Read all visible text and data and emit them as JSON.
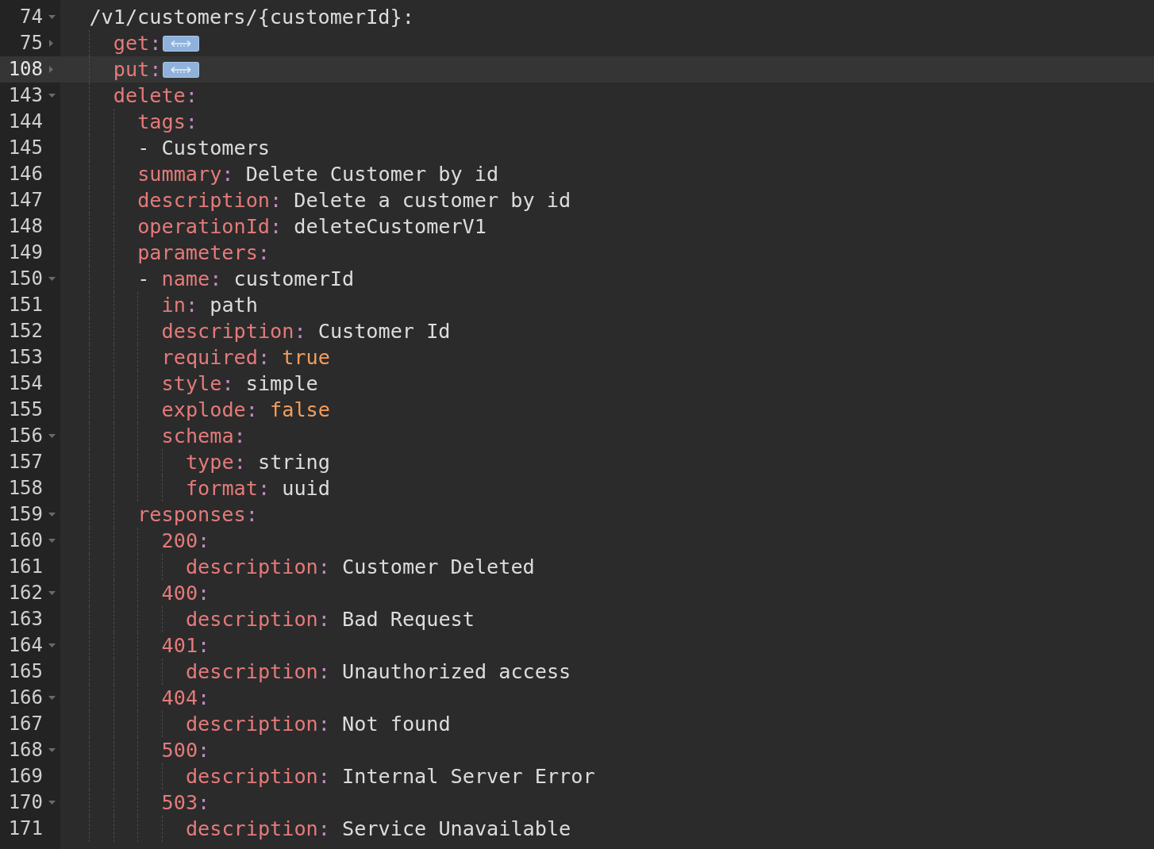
{
  "editor": {
    "lines": [
      {
        "number": "74",
        "kind": "expanded",
        "active": false,
        "tokens": [
          {
            "kind": "text",
            "text": "/v1/customers/{customerId}:"
          }
        ],
        "children": [
          {
            "number": "75",
            "kind": "collapsed",
            "active": false,
            "tokens": [
              {
                "kind": "key",
                "text": "get"
              },
              {
                "kind": "colon",
                "text": ":"
              }
            ]
          },
          {
            "number": "108",
            "kind": "collapsed",
            "active": true,
            "tokens": [
              {
                "kind": "key",
                "text": "put"
              },
              {
                "kind": "colon",
                "text": ":"
              }
            ]
          },
          {
            "number": "143",
            "kind": "expanded",
            "active": false,
            "tokens": [
              {
                "kind": "key",
                "text": "delete"
              },
              {
                "kind": "colon",
                "text": ":"
              }
            ],
            "children": [
              {
                "number": "144",
                "kind": "plain",
                "active": false,
                "tokens": [
                  {
                    "kind": "key",
                    "text": "tags"
                  },
                  {
                    "kind": "colon",
                    "text": ":"
                  }
                ]
              },
              {
                "number": "145",
                "kind": "plain",
                "active": false,
                "tokens": [
                  {
                    "kind": "text",
                    "text": "- Customers"
                  }
                ]
              },
              {
                "number": "146",
                "kind": "plain",
                "active": false,
                "tokens": [
                  {
                    "kind": "key",
                    "text": "summary"
                  },
                  {
                    "kind": "colon",
                    "text": ":"
                  },
                  {
                    "kind": "text",
                    "text": " Delete Customer by id"
                  }
                ]
              },
              {
                "number": "147",
                "kind": "plain",
                "active": false,
                "tokens": [
                  {
                    "kind": "key",
                    "text": "description"
                  },
                  {
                    "kind": "colon",
                    "text": ":"
                  },
                  {
                    "kind": "text",
                    "text": " Delete a customer by id"
                  }
                ]
              },
              {
                "number": "148",
                "kind": "plain",
                "active": false,
                "tokens": [
                  {
                    "kind": "key",
                    "text": "operationId"
                  },
                  {
                    "kind": "colon",
                    "text": ":"
                  },
                  {
                    "kind": "text",
                    "text": " deleteCustomerV1"
                  }
                ]
              },
              {
                "number": "149",
                "kind": "plain",
                "active": false,
                "tokens": [
                  {
                    "kind": "key",
                    "text": "parameters"
                  },
                  {
                    "kind": "colon",
                    "text": ":"
                  }
                ]
              },
              {
                "number": "150",
                "kind": "expanded",
                "active": false,
                "tokens": [
                  {
                    "kind": "text",
                    "text": "- "
                  },
                  {
                    "kind": "key",
                    "text": "name"
                  },
                  {
                    "kind": "colon",
                    "text": ":"
                  },
                  {
                    "kind": "text",
                    "text": " customerId"
                  }
                ],
                "children": [
                  {
                    "number": "151",
                    "kind": "plain",
                    "active": false,
                    "tokens": [
                      {
                        "kind": "key",
                        "text": "in"
                      },
                      {
                        "kind": "colon",
                        "text": ":"
                      },
                      {
                        "kind": "text",
                        "text": " path"
                      }
                    ]
                  },
                  {
                    "number": "152",
                    "kind": "plain",
                    "active": false,
                    "tokens": [
                      {
                        "kind": "key",
                        "text": "description"
                      },
                      {
                        "kind": "colon",
                        "text": ":"
                      },
                      {
                        "kind": "text",
                        "text": " Customer Id"
                      }
                    ]
                  },
                  {
                    "number": "153",
                    "kind": "plain",
                    "active": false,
                    "tokens": [
                      {
                        "kind": "key",
                        "text": "required"
                      },
                      {
                        "kind": "colon",
                        "text": ":"
                      },
                      {
                        "kind": "literal",
                        "text": " true"
                      }
                    ]
                  },
                  {
                    "number": "154",
                    "kind": "plain",
                    "active": false,
                    "tokens": [
                      {
                        "kind": "key",
                        "text": "style"
                      },
                      {
                        "kind": "colon",
                        "text": ":"
                      },
                      {
                        "kind": "text",
                        "text": " simple"
                      }
                    ]
                  },
                  {
                    "number": "155",
                    "kind": "plain",
                    "active": false,
                    "tokens": [
                      {
                        "kind": "key",
                        "text": "explode"
                      },
                      {
                        "kind": "colon",
                        "text": ":"
                      },
                      {
                        "kind": "literal",
                        "text": " false"
                      }
                    ]
                  },
                  {
                    "number": "156",
                    "kind": "expanded",
                    "active": false,
                    "tokens": [
                      {
                        "kind": "key",
                        "text": "schema"
                      },
                      {
                        "kind": "colon",
                        "text": ":"
                      }
                    ],
                    "children": [
                      {
                        "number": "157",
                        "kind": "plain",
                        "active": false,
                        "tokens": [
                          {
                            "kind": "key",
                            "text": "type"
                          },
                          {
                            "kind": "colon",
                            "text": ":"
                          },
                          {
                            "kind": "text",
                            "text": " string"
                          }
                        ]
                      },
                      {
                        "number": "158",
                        "kind": "plain",
                        "active": false,
                        "tokens": [
                          {
                            "kind": "key",
                            "text": "format"
                          },
                          {
                            "kind": "colon",
                            "text": ":"
                          },
                          {
                            "kind": "text",
                            "text": " uuid"
                          }
                        ]
                      }
                    ]
                  }
                ]
              },
              {
                "number": "159",
                "kind": "expanded",
                "active": false,
                "tokens": [
                  {
                    "kind": "key",
                    "text": "responses"
                  },
                  {
                    "kind": "colon",
                    "text": ":"
                  }
                ],
                "children": [
                  {
                    "number": "160",
                    "kind": "expanded",
                    "active": false,
                    "tokens": [
                      {
                        "kind": "key",
                        "text": "200"
                      },
                      {
                        "kind": "colon",
                        "text": ":"
                      }
                    ],
                    "children": [
                      {
                        "number": "161",
                        "kind": "plain",
                        "active": false,
                        "tokens": [
                          {
                            "kind": "key",
                            "text": "description"
                          },
                          {
                            "kind": "colon",
                            "text": ":"
                          },
                          {
                            "kind": "text",
                            "text": " Customer Deleted"
                          }
                        ]
                      }
                    ]
                  },
                  {
                    "number": "162",
                    "kind": "expanded",
                    "active": false,
                    "tokens": [
                      {
                        "kind": "key",
                        "text": "400"
                      },
                      {
                        "kind": "colon",
                        "text": ":"
                      }
                    ],
                    "children": [
                      {
                        "number": "163",
                        "kind": "plain",
                        "active": false,
                        "tokens": [
                          {
                            "kind": "key",
                            "text": "description"
                          },
                          {
                            "kind": "colon",
                            "text": ":"
                          },
                          {
                            "kind": "text",
                            "text": " Bad Request"
                          }
                        ]
                      }
                    ]
                  },
                  {
                    "number": "164",
                    "kind": "expanded",
                    "active": false,
                    "tokens": [
                      {
                        "kind": "key",
                        "text": "401"
                      },
                      {
                        "kind": "colon",
                        "text": ":"
                      }
                    ],
                    "children": [
                      {
                        "number": "165",
                        "kind": "plain",
                        "active": false,
                        "tokens": [
                          {
                            "kind": "key",
                            "text": "description"
                          },
                          {
                            "kind": "colon",
                            "text": ":"
                          },
                          {
                            "kind": "text",
                            "text": " Unauthorized access"
                          }
                        ]
                      }
                    ]
                  },
                  {
                    "number": "166",
                    "kind": "expanded",
                    "active": false,
                    "tokens": [
                      {
                        "kind": "key",
                        "text": "404"
                      },
                      {
                        "kind": "colon",
                        "text": ":"
                      }
                    ],
                    "children": [
                      {
                        "number": "167",
                        "kind": "plain",
                        "active": false,
                        "tokens": [
                          {
                            "kind": "key",
                            "text": "description"
                          },
                          {
                            "kind": "colon",
                            "text": ":"
                          },
                          {
                            "kind": "text",
                            "text": " Not found"
                          }
                        ]
                      }
                    ]
                  },
                  {
                    "number": "168",
                    "kind": "expanded",
                    "active": false,
                    "tokens": [
                      {
                        "kind": "key",
                        "text": "500"
                      },
                      {
                        "kind": "colon",
                        "text": ":"
                      }
                    ],
                    "children": [
                      {
                        "number": "169",
                        "kind": "plain",
                        "active": false,
                        "tokens": [
                          {
                            "kind": "key",
                            "text": "description"
                          },
                          {
                            "kind": "colon",
                            "text": ":"
                          },
                          {
                            "kind": "text",
                            "text": " Internal Server Error"
                          }
                        ]
                      }
                    ]
                  },
                  {
                    "number": "170",
                    "kind": "expanded",
                    "active": false,
                    "tokens": [
                      {
                        "kind": "key",
                        "text": "503"
                      },
                      {
                        "kind": "colon",
                        "text": ":"
                      }
                    ],
                    "children": [
                      {
                        "number": "171",
                        "kind": "plain",
                        "active": false,
                        "tokens": [
                          {
                            "kind": "key",
                            "text": "description"
                          },
                          {
                            "kind": "colon",
                            "text": ":"
                          },
                          {
                            "kind": "text",
                            "text": " Service Unavailable"
                          }
                        ]
                      }
                    ]
                  }
                ]
              }
            ]
          }
        ]
      }
    ]
  }
}
